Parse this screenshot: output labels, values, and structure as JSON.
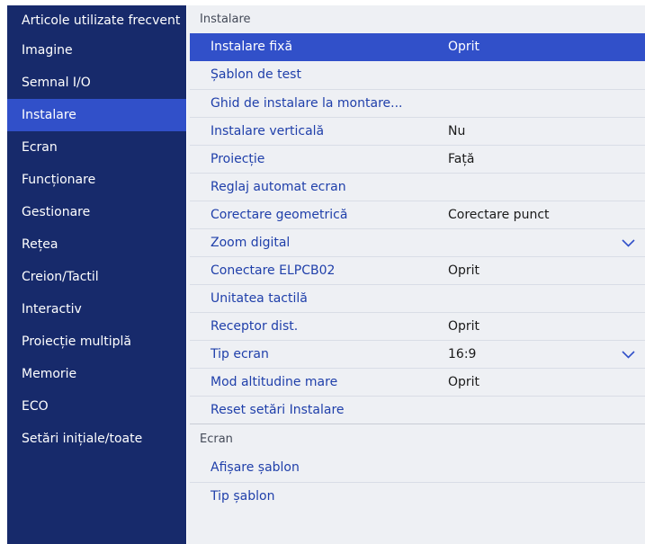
{
  "sidebar": {
    "items": [
      {
        "label": "Articole utilizate frecvent"
      },
      {
        "label": "Imagine"
      },
      {
        "label": "Semnal I/O"
      },
      {
        "label": "Instalare"
      },
      {
        "label": "Ecran"
      },
      {
        "label": "Funcționare"
      },
      {
        "label": "Gestionare"
      },
      {
        "label": "Rețea"
      },
      {
        "label": "Creion/Tactil"
      },
      {
        "label": "Interactiv"
      },
      {
        "label": "Proiecție multiplă"
      },
      {
        "label": "Memorie"
      },
      {
        "label": "ECO"
      },
      {
        "label": "Setări inițiale/toate"
      }
    ],
    "active_index": 3
  },
  "install": {
    "title": "Instalare",
    "rows": [
      {
        "label": "Instalare fixă",
        "value": "Oprit"
      },
      {
        "label": "Șablon de test",
        "value": ""
      },
      {
        "label": "Ghid de instalare la montare...",
        "value": ""
      },
      {
        "label": "Instalare verticală",
        "value": "Nu"
      },
      {
        "label": "Proiecție",
        "value": "Față"
      },
      {
        "label": "Reglaj automat ecran",
        "value": ""
      },
      {
        "label": "Corectare geometrică",
        "value": "Corectare punct"
      },
      {
        "label": "Zoom digital",
        "value": "",
        "icon": "chevron-down-icon"
      },
      {
        "label": "Conectare ELPCB02",
        "value": "Oprit"
      },
      {
        "label": "Unitatea tactilă",
        "value": ""
      },
      {
        "label": "Receptor dist.",
        "value": "Oprit"
      },
      {
        "label": "Tip ecran",
        "value": "16:9",
        "icon": "chevron-down-icon"
      },
      {
        "label": "Mod altitudine mare",
        "value": "Oprit"
      },
      {
        "label": "Reset setări Instalare",
        "value": ""
      }
    ]
  },
  "screen": {
    "title": "Ecran",
    "rows": [
      {
        "label": "Afișare șablon",
        "value": ""
      },
      {
        "label": "Tip șablon",
        "value": ""
      }
    ]
  },
  "colors": {
    "sidebar_bg": "#172a6b",
    "highlight": "#3150c9",
    "panel_bg": "#eef0f4",
    "link_text": "#1f3faa"
  }
}
